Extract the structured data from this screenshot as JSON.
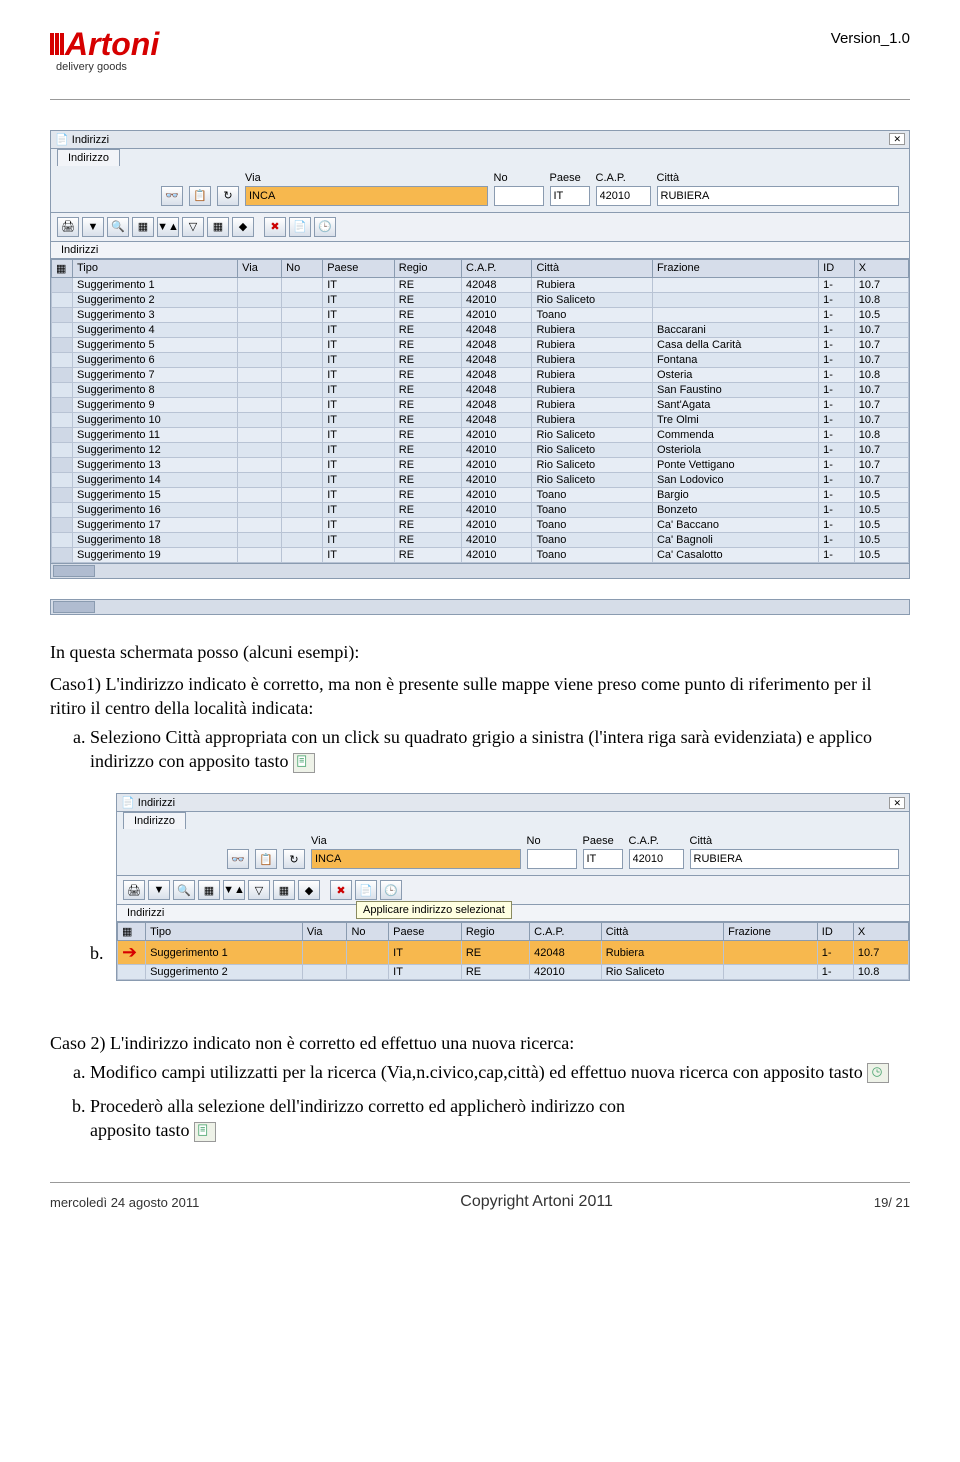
{
  "header": {
    "version": "Version_1.0",
    "logo_title": "Artoni",
    "logo_sub": "delivery goods"
  },
  "sap1": {
    "title": "Indirizzi",
    "tab": "Indirizzo",
    "form": {
      "via_label": "Via",
      "via_value": "INCA",
      "no_label": "No",
      "no_value": "",
      "paese_label": "Paese",
      "paese_value": "IT",
      "cap_label": "C.A.P.",
      "cap_value": "42010",
      "citta_label": "Città",
      "citta_value": "RUBIERA"
    },
    "subhead": "Indirizzi",
    "cols": {
      "tipo": "Tipo",
      "via": "Via",
      "no": "No",
      "paese": "Paese",
      "regio": "Regio",
      "cap": "C.A.P.",
      "citta": "Città",
      "frazione": "Frazione",
      "id": "ID",
      "x": "X"
    },
    "rows": [
      {
        "tipo": "Suggerimento 1",
        "via": "",
        "no": "",
        "paese": "IT",
        "regio": "RE",
        "cap": "42048",
        "citta": "Rubiera",
        "frazione": "",
        "id": "1-",
        "x": "10.7"
      },
      {
        "tipo": "Suggerimento 2",
        "via": "",
        "no": "",
        "paese": "IT",
        "regio": "RE",
        "cap": "42010",
        "citta": "Rio Saliceto",
        "frazione": "",
        "id": "1-",
        "x": "10.8"
      },
      {
        "tipo": "Suggerimento 3",
        "via": "",
        "no": "",
        "paese": "IT",
        "regio": "RE",
        "cap": "42010",
        "citta": "Toano",
        "frazione": "",
        "id": "1-",
        "x": "10.5"
      },
      {
        "tipo": "Suggerimento 4",
        "via": "",
        "no": "",
        "paese": "IT",
        "regio": "RE",
        "cap": "42048",
        "citta": "Rubiera",
        "frazione": "Baccarani",
        "id": "1-",
        "x": "10.7"
      },
      {
        "tipo": "Suggerimento 5",
        "via": "",
        "no": "",
        "paese": "IT",
        "regio": "RE",
        "cap": "42048",
        "citta": "Rubiera",
        "frazione": "Casa della Carità",
        "id": "1-",
        "x": "10.7"
      },
      {
        "tipo": "Suggerimento 6",
        "via": "",
        "no": "",
        "paese": "IT",
        "regio": "RE",
        "cap": "42048",
        "citta": "Rubiera",
        "frazione": "Fontana",
        "id": "1-",
        "x": "10.7"
      },
      {
        "tipo": "Suggerimento 7",
        "via": "",
        "no": "",
        "paese": "IT",
        "regio": "RE",
        "cap": "42048",
        "citta": "Rubiera",
        "frazione": "Osteria",
        "id": "1-",
        "x": "10.8"
      },
      {
        "tipo": "Suggerimento 8",
        "via": "",
        "no": "",
        "paese": "IT",
        "regio": "RE",
        "cap": "42048",
        "citta": "Rubiera",
        "frazione": "San Faustino",
        "id": "1-",
        "x": "10.7"
      },
      {
        "tipo": "Suggerimento 9",
        "via": "",
        "no": "",
        "paese": "IT",
        "regio": "RE",
        "cap": "42048",
        "citta": "Rubiera",
        "frazione": "Sant'Agata",
        "id": "1-",
        "x": "10.7"
      },
      {
        "tipo": "Suggerimento 10",
        "via": "",
        "no": "",
        "paese": "IT",
        "regio": "RE",
        "cap": "42048",
        "citta": "Rubiera",
        "frazione": "Tre Olmi",
        "id": "1-",
        "x": "10.7"
      },
      {
        "tipo": "Suggerimento 11",
        "via": "",
        "no": "",
        "paese": "IT",
        "regio": "RE",
        "cap": "42010",
        "citta": "Rio Saliceto",
        "frazione": "Commenda",
        "id": "1-",
        "x": "10.8"
      },
      {
        "tipo": "Suggerimento 12",
        "via": "",
        "no": "",
        "paese": "IT",
        "regio": "RE",
        "cap": "42010",
        "citta": "Rio Saliceto",
        "frazione": "Osteriola",
        "id": "1-",
        "x": "10.7"
      },
      {
        "tipo": "Suggerimento 13",
        "via": "",
        "no": "",
        "paese": "IT",
        "regio": "RE",
        "cap": "42010",
        "citta": "Rio Saliceto",
        "frazione": "Ponte Vettigano",
        "id": "1-",
        "x": "10.7"
      },
      {
        "tipo": "Suggerimento 14",
        "via": "",
        "no": "",
        "paese": "IT",
        "regio": "RE",
        "cap": "42010",
        "citta": "Rio Saliceto",
        "frazione": "San Lodovico",
        "id": "1-",
        "x": "10.7"
      },
      {
        "tipo": "Suggerimento 15",
        "via": "",
        "no": "",
        "paese": "IT",
        "regio": "RE",
        "cap": "42010",
        "citta": "Toano",
        "frazione": "Bargio",
        "id": "1-",
        "x": "10.5"
      },
      {
        "tipo": "Suggerimento 16",
        "via": "",
        "no": "",
        "paese": "IT",
        "regio": "RE",
        "cap": "42010",
        "citta": "Toano",
        "frazione": "Bonzeto",
        "id": "1-",
        "x": "10.5"
      },
      {
        "tipo": "Suggerimento 17",
        "via": "",
        "no": "",
        "paese": "IT",
        "regio": "RE",
        "cap": "42010",
        "citta": "Toano",
        "frazione": "Ca' Baccano",
        "id": "1-",
        "x": "10.5"
      },
      {
        "tipo": "Suggerimento 18",
        "via": "",
        "no": "",
        "paese": "IT",
        "regio": "RE",
        "cap": "42010",
        "citta": "Toano",
        "frazione": "Ca' Bagnoli",
        "id": "1-",
        "x": "10.5"
      },
      {
        "tipo": "Suggerimento 19",
        "via": "",
        "no": "",
        "paese": "IT",
        "regio": "RE",
        "cap": "42010",
        "citta": "Toano",
        "frazione": "Ca' Casalotto",
        "id": "1-",
        "x": "10.5"
      }
    ]
  },
  "text": {
    "intro": "In questa schermata posso (alcuni esempi):",
    "caso1": "Caso1) L'indirizzo indicato è corretto, ma non è presente sulle mappe viene preso come punto di riferimento per il ritiro il centro della località indicata:",
    "li_a": "Seleziono Città appropriata con un click su quadrato grigio a sinistra (l'intera riga sarà evidenziata) e applico indirizzo con apposito tasto",
    "li_b": "b.",
    "caso2": "Caso 2) L'indirizzo indicato non è corretto ed effettuo una nuova ricerca:",
    "li2_a": "Modifico campi utilizzatti per la ricerca (Via,n.civico,cap,città) ed effettuo nuova ricerca con apposito tasto",
    "li2_b_1": "Procederò alla selezione dell'indirizzo corretto ed applicherò indirizzo con",
    "li2_b_2": "apposito tasto"
  },
  "sap2": {
    "title": "Indirizzi",
    "tab": "Indirizzo",
    "form": {
      "via_label": "Via",
      "via_value": "INCA",
      "no_label": "No",
      "no_value": "",
      "paese_label": "Paese",
      "paese_value": "IT",
      "cap_label": "C.A.P.",
      "cap_value": "42010",
      "citta_label": "Città",
      "citta_value": "RUBIERA"
    },
    "tooltip": "Applicare indirizzo selezionat",
    "subhead": "Indirizzi",
    "cols": {
      "tipo": "Tipo",
      "via": "Via",
      "no": "No",
      "paese": "Paese",
      "regio": "Regio",
      "cap": "C.A.P.",
      "citta": "Città",
      "frazione": "Frazione",
      "id": "ID",
      "x": "X"
    },
    "rows": [
      {
        "tipo": "Suggerimento 1",
        "via": "",
        "no": "",
        "paese": "IT",
        "regio": "RE",
        "cap": "42048",
        "citta": "Rubiera",
        "frazione": "",
        "id": "1-",
        "x": "10.7",
        "sel": true
      },
      {
        "tipo": "Suggerimento 2",
        "via": "",
        "no": "",
        "paese": "IT",
        "regio": "RE",
        "cap": "42010",
        "citta": "Rio Saliceto",
        "frazione": "",
        "id": "1-",
        "x": "10.8"
      }
    ]
  },
  "footer": {
    "left": "mercoledì 24 agosto 2011",
    "center": "Copyright Artoni 2011",
    "right": "19/ 21"
  }
}
